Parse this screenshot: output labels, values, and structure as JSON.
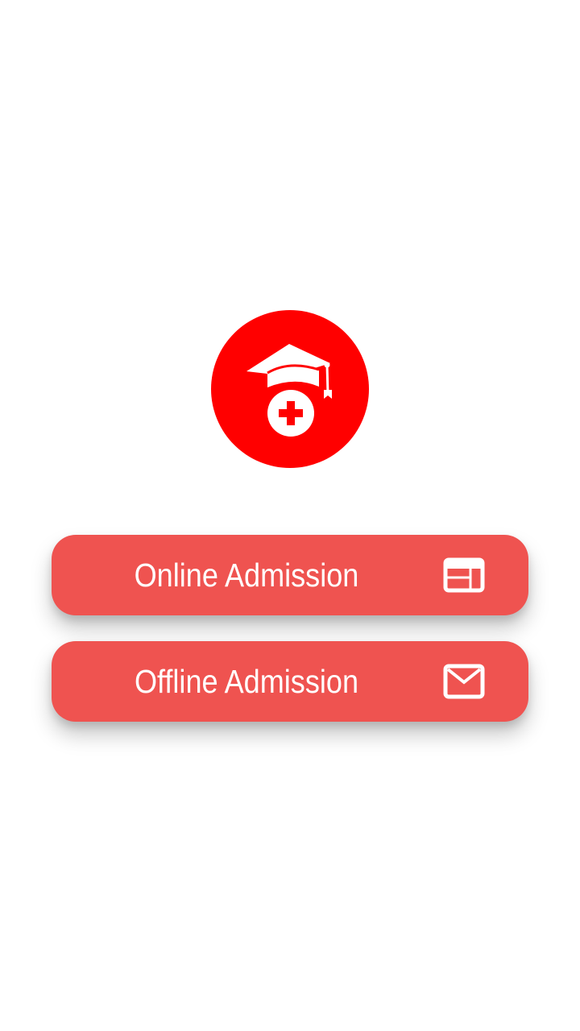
{
  "logo": {
    "icon": "graduation-cap-medical-cross-icon",
    "color": "#ff0000"
  },
  "buttons": {
    "online": {
      "label": "Online Admission",
      "icon": "browser-window-icon"
    },
    "offline": {
      "label": "Offline Admission",
      "icon": "envelope-icon"
    },
    "color": "#ef5350"
  }
}
